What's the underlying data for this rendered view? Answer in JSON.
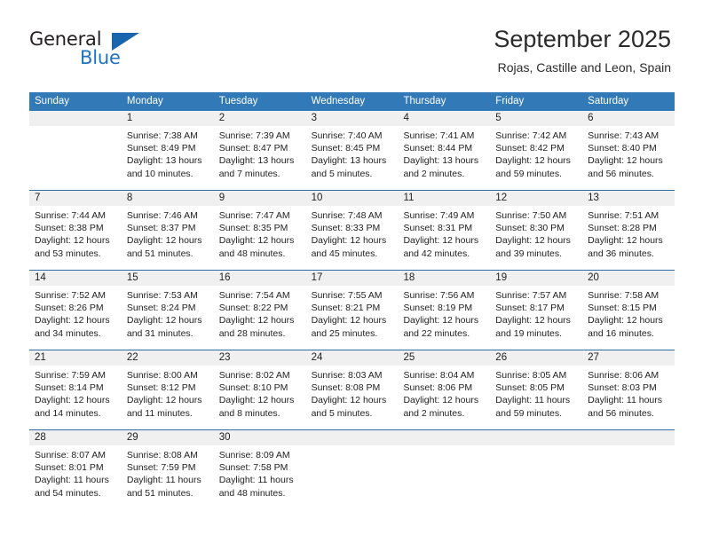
{
  "brand": {
    "name_top": "General",
    "name_bottom": "Blue",
    "triangle_icon": "triangle-icon",
    "accent_color": "#1a66ae"
  },
  "header": {
    "title": "September 2025",
    "subtitle": "Rojas, Castille and Leon, Spain"
  },
  "calendar": {
    "header_color": "#3279b8",
    "weekdays": [
      "Sunday",
      "Monday",
      "Tuesday",
      "Wednesday",
      "Thursday",
      "Friday",
      "Saturday"
    ],
    "weeks": [
      [
        {
          "day": "",
          "sunrise": "",
          "sunset": "",
          "daylight": "",
          "empty": true
        },
        {
          "day": "1",
          "sunrise": "Sunrise: 7:38 AM",
          "sunset": "Sunset: 8:49 PM",
          "daylight": "Daylight: 13 hours and 10 minutes."
        },
        {
          "day": "2",
          "sunrise": "Sunrise: 7:39 AM",
          "sunset": "Sunset: 8:47 PM",
          "daylight": "Daylight: 13 hours and 7 minutes."
        },
        {
          "day": "3",
          "sunrise": "Sunrise: 7:40 AM",
          "sunset": "Sunset: 8:45 PM",
          "daylight": "Daylight: 13 hours and 5 minutes."
        },
        {
          "day": "4",
          "sunrise": "Sunrise: 7:41 AM",
          "sunset": "Sunset: 8:44 PM",
          "daylight": "Daylight: 13 hours and 2 minutes."
        },
        {
          "day": "5",
          "sunrise": "Sunrise: 7:42 AM",
          "sunset": "Sunset: 8:42 PM",
          "daylight": "Daylight: 12 hours and 59 minutes."
        },
        {
          "day": "6",
          "sunrise": "Sunrise: 7:43 AM",
          "sunset": "Sunset: 8:40 PM",
          "daylight": "Daylight: 12 hours and 56 minutes."
        }
      ],
      [
        {
          "day": "7",
          "sunrise": "Sunrise: 7:44 AM",
          "sunset": "Sunset: 8:38 PM",
          "daylight": "Daylight: 12 hours and 53 minutes."
        },
        {
          "day": "8",
          "sunrise": "Sunrise: 7:46 AM",
          "sunset": "Sunset: 8:37 PM",
          "daylight": "Daylight: 12 hours and 51 minutes."
        },
        {
          "day": "9",
          "sunrise": "Sunrise: 7:47 AM",
          "sunset": "Sunset: 8:35 PM",
          "daylight": "Daylight: 12 hours and 48 minutes."
        },
        {
          "day": "10",
          "sunrise": "Sunrise: 7:48 AM",
          "sunset": "Sunset: 8:33 PM",
          "daylight": "Daylight: 12 hours and 45 minutes."
        },
        {
          "day": "11",
          "sunrise": "Sunrise: 7:49 AM",
          "sunset": "Sunset: 8:31 PM",
          "daylight": "Daylight: 12 hours and 42 minutes."
        },
        {
          "day": "12",
          "sunrise": "Sunrise: 7:50 AM",
          "sunset": "Sunset: 8:30 PM",
          "daylight": "Daylight: 12 hours and 39 minutes."
        },
        {
          "day": "13",
          "sunrise": "Sunrise: 7:51 AM",
          "sunset": "Sunset: 8:28 PM",
          "daylight": "Daylight: 12 hours and 36 minutes."
        }
      ],
      [
        {
          "day": "14",
          "sunrise": "Sunrise: 7:52 AM",
          "sunset": "Sunset: 8:26 PM",
          "daylight": "Daylight: 12 hours and 34 minutes."
        },
        {
          "day": "15",
          "sunrise": "Sunrise: 7:53 AM",
          "sunset": "Sunset: 8:24 PM",
          "daylight": "Daylight: 12 hours and 31 minutes."
        },
        {
          "day": "16",
          "sunrise": "Sunrise: 7:54 AM",
          "sunset": "Sunset: 8:22 PM",
          "daylight": "Daylight: 12 hours and 28 minutes."
        },
        {
          "day": "17",
          "sunrise": "Sunrise: 7:55 AM",
          "sunset": "Sunset: 8:21 PM",
          "daylight": "Daylight: 12 hours and 25 minutes."
        },
        {
          "day": "18",
          "sunrise": "Sunrise: 7:56 AM",
          "sunset": "Sunset: 8:19 PM",
          "daylight": "Daylight: 12 hours and 22 minutes."
        },
        {
          "day": "19",
          "sunrise": "Sunrise: 7:57 AM",
          "sunset": "Sunset: 8:17 PM",
          "daylight": "Daylight: 12 hours and 19 minutes."
        },
        {
          "day": "20",
          "sunrise": "Sunrise: 7:58 AM",
          "sunset": "Sunset: 8:15 PM",
          "daylight": "Daylight: 12 hours and 16 minutes."
        }
      ],
      [
        {
          "day": "21",
          "sunrise": "Sunrise: 7:59 AM",
          "sunset": "Sunset: 8:14 PM",
          "daylight": "Daylight: 12 hours and 14 minutes."
        },
        {
          "day": "22",
          "sunrise": "Sunrise: 8:00 AM",
          "sunset": "Sunset: 8:12 PM",
          "daylight": "Daylight: 12 hours and 11 minutes."
        },
        {
          "day": "23",
          "sunrise": "Sunrise: 8:02 AM",
          "sunset": "Sunset: 8:10 PM",
          "daylight": "Daylight: 12 hours and 8 minutes."
        },
        {
          "day": "24",
          "sunrise": "Sunrise: 8:03 AM",
          "sunset": "Sunset: 8:08 PM",
          "daylight": "Daylight: 12 hours and 5 minutes."
        },
        {
          "day": "25",
          "sunrise": "Sunrise: 8:04 AM",
          "sunset": "Sunset: 8:06 PM",
          "daylight": "Daylight: 12 hours and 2 minutes."
        },
        {
          "day": "26",
          "sunrise": "Sunrise: 8:05 AM",
          "sunset": "Sunset: 8:05 PM",
          "daylight": "Daylight: 11 hours and 59 minutes."
        },
        {
          "day": "27",
          "sunrise": "Sunrise: 8:06 AM",
          "sunset": "Sunset: 8:03 PM",
          "daylight": "Daylight: 11 hours and 56 minutes."
        }
      ],
      [
        {
          "day": "28",
          "sunrise": "Sunrise: 8:07 AM",
          "sunset": "Sunset: 8:01 PM",
          "daylight": "Daylight: 11 hours and 54 minutes."
        },
        {
          "day": "29",
          "sunrise": "Sunrise: 8:08 AM",
          "sunset": "Sunset: 7:59 PM",
          "daylight": "Daylight: 11 hours and 51 minutes."
        },
        {
          "day": "30",
          "sunrise": "Sunrise: 8:09 AM",
          "sunset": "Sunset: 7:58 PM",
          "daylight": "Daylight: 11 hours and 48 minutes."
        },
        {
          "day": "",
          "sunrise": "",
          "sunset": "",
          "daylight": "",
          "empty": true
        },
        {
          "day": "",
          "sunrise": "",
          "sunset": "",
          "daylight": "",
          "empty": true
        },
        {
          "day": "",
          "sunrise": "",
          "sunset": "",
          "daylight": "",
          "empty": true
        },
        {
          "day": "",
          "sunrise": "",
          "sunset": "",
          "daylight": "",
          "empty": true
        }
      ]
    ]
  }
}
